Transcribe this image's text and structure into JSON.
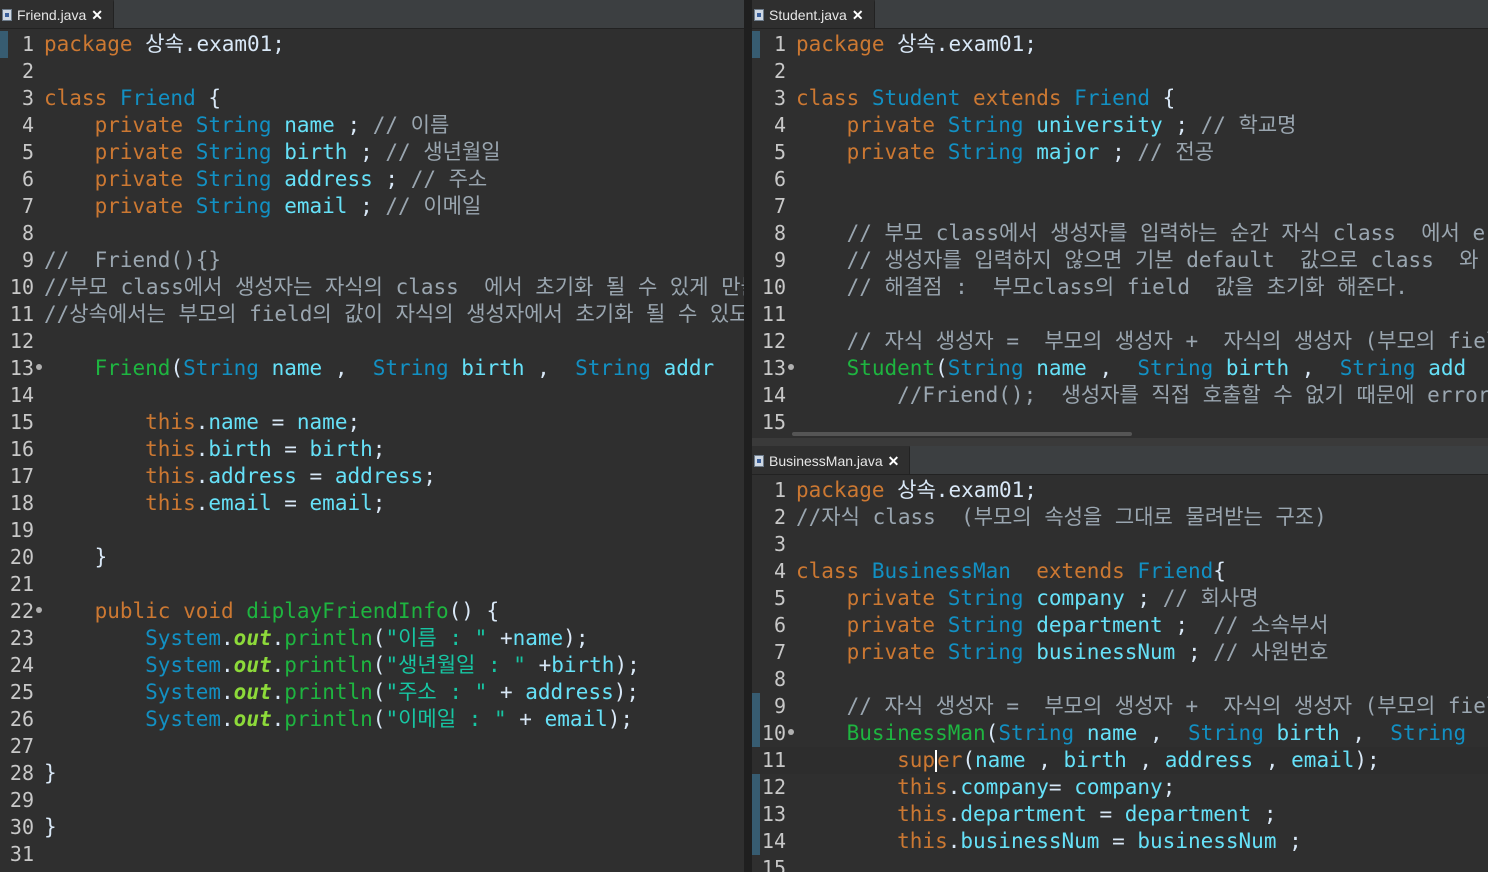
{
  "tabs": {
    "friend": "Friend.java",
    "student": "Student.java",
    "business": "BusinessMan.java"
  },
  "friend_lines": [
    [
      {
        "t": "package ",
        "c": "kw"
      },
      {
        "t": "상속.exam01;",
        "c": "pl"
      }
    ],
    [],
    [
      {
        "t": "class ",
        "c": "kw"
      },
      {
        "t": "Friend",
        "c": "ty"
      },
      {
        "t": " {",
        "c": "pl"
      }
    ],
    [
      {
        "t": "    private ",
        "c": "kw"
      },
      {
        "t": "String ",
        "c": "ty"
      },
      {
        "t": "name",
        "c": "fld"
      },
      {
        "t": " ; ",
        "c": "pl"
      },
      {
        "t": "// 이름",
        "c": "cm"
      }
    ],
    [
      {
        "t": "    private ",
        "c": "kw"
      },
      {
        "t": "String ",
        "c": "ty"
      },
      {
        "t": "birth",
        "c": "fld"
      },
      {
        "t": " ; ",
        "c": "pl"
      },
      {
        "t": "// 생년월일",
        "c": "cm"
      }
    ],
    [
      {
        "t": "    private ",
        "c": "kw"
      },
      {
        "t": "String ",
        "c": "ty"
      },
      {
        "t": "address",
        "c": "fld"
      },
      {
        "t": " ; ",
        "c": "pl"
      },
      {
        "t": "// 주소",
        "c": "cm"
      }
    ],
    [
      {
        "t": "    private ",
        "c": "kw"
      },
      {
        "t": "String ",
        "c": "ty"
      },
      {
        "t": "email",
        "c": "fld"
      },
      {
        "t": " ; ",
        "c": "pl"
      },
      {
        "t": "// 이메일",
        "c": "cm"
      }
    ],
    [],
    [
      {
        "t": "//  Friend(){}",
        "c": "cm"
      }
    ],
    [
      {
        "t": "//부모 class에서 생성자는 자식의 class  에서 초기화 될 수 있게 만들어야",
        "c": "cm"
      }
    ],
    [
      {
        "t": "//상속에서는 부모의 field의 값이 자식의 생성자에서 초기화 될 수 있도록 정",
        "c": "cm"
      }
    ],
    [],
    [
      {
        "t": "    Friend",
        "c": "meth"
      },
      {
        "t": "(",
        "c": "pl"
      },
      {
        "t": "String ",
        "c": "ty"
      },
      {
        "t": "name",
        "c": "fld"
      },
      {
        "t": " ,  ",
        "c": "pl"
      },
      {
        "t": "String ",
        "c": "ty"
      },
      {
        "t": "birth",
        "c": "fld"
      },
      {
        "t": " ,  ",
        "c": "pl"
      },
      {
        "t": "String ",
        "c": "ty"
      },
      {
        "t": "addr",
        "c": "fld"
      }
    ],
    [],
    [
      {
        "t": "        this",
        "c": "kw"
      },
      {
        "t": ".",
        "c": "pl"
      },
      {
        "t": "name",
        "c": "fld"
      },
      {
        "t": " = ",
        "c": "pl"
      },
      {
        "t": "name",
        "c": "fld"
      },
      {
        "t": ";",
        "c": "pl"
      }
    ],
    [
      {
        "t": "        this",
        "c": "kw"
      },
      {
        "t": ".",
        "c": "pl"
      },
      {
        "t": "birth",
        "c": "fld"
      },
      {
        "t": " = ",
        "c": "pl"
      },
      {
        "t": "birth",
        "c": "fld"
      },
      {
        "t": ";",
        "c": "pl"
      }
    ],
    [
      {
        "t": "        this",
        "c": "kw"
      },
      {
        "t": ".",
        "c": "pl"
      },
      {
        "t": "address",
        "c": "fld"
      },
      {
        "t": " = ",
        "c": "pl"
      },
      {
        "t": "address",
        "c": "fld"
      },
      {
        "t": ";",
        "c": "pl"
      }
    ],
    [
      {
        "t": "        this",
        "c": "kw"
      },
      {
        "t": ".",
        "c": "pl"
      },
      {
        "t": "email",
        "c": "fld"
      },
      {
        "t": " = ",
        "c": "pl"
      },
      {
        "t": "email",
        "c": "fld"
      },
      {
        "t": ";",
        "c": "pl"
      }
    ],
    [],
    [
      {
        "t": "    }",
        "c": "pl"
      }
    ],
    [],
    [
      {
        "t": "    public void ",
        "c": "kw"
      },
      {
        "t": "diplayFriendInfo",
        "c": "meth"
      },
      {
        "t": "() {",
        "c": "pl"
      }
    ],
    [
      {
        "t": "        System",
        "c": "ty"
      },
      {
        "t": ".",
        "c": "pl"
      },
      {
        "t": "out",
        "c": "stat"
      },
      {
        "t": ".",
        "c": "pl"
      },
      {
        "t": "println",
        "c": "meth"
      },
      {
        "t": "(",
        "c": "pl"
      },
      {
        "t": "\"이름 : \"",
        "c": "str"
      },
      {
        "t": " +",
        "c": "pl"
      },
      {
        "t": "name",
        "c": "fld"
      },
      {
        "t": ");",
        "c": "pl"
      }
    ],
    [
      {
        "t": "        System",
        "c": "ty"
      },
      {
        "t": ".",
        "c": "pl"
      },
      {
        "t": "out",
        "c": "stat"
      },
      {
        "t": ".",
        "c": "pl"
      },
      {
        "t": "println",
        "c": "meth"
      },
      {
        "t": "(",
        "c": "pl"
      },
      {
        "t": "\"생년월일 : \"",
        "c": "str"
      },
      {
        "t": " +",
        "c": "pl"
      },
      {
        "t": "birth",
        "c": "fld"
      },
      {
        "t": ");",
        "c": "pl"
      }
    ],
    [
      {
        "t": "        System",
        "c": "ty"
      },
      {
        "t": ".",
        "c": "pl"
      },
      {
        "t": "out",
        "c": "stat"
      },
      {
        "t": ".",
        "c": "pl"
      },
      {
        "t": "println",
        "c": "meth"
      },
      {
        "t": "(",
        "c": "pl"
      },
      {
        "t": "\"주소 : \"",
        "c": "str"
      },
      {
        "t": " + ",
        "c": "pl"
      },
      {
        "t": "address",
        "c": "fld"
      },
      {
        "t": ");",
        "c": "pl"
      }
    ],
    [
      {
        "t": "        System",
        "c": "ty"
      },
      {
        "t": ".",
        "c": "pl"
      },
      {
        "t": "out",
        "c": "stat"
      },
      {
        "t": ".",
        "c": "pl"
      },
      {
        "t": "println",
        "c": "meth"
      },
      {
        "t": "(",
        "c": "pl"
      },
      {
        "t": "\"이메일 : \"",
        "c": "str"
      },
      {
        "t": " + ",
        "c": "pl"
      },
      {
        "t": "email",
        "c": "fld"
      },
      {
        "t": ");",
        "c": "pl"
      }
    ],
    [],
    [
      {
        "t": "}",
        "c": "pl"
      }
    ],
    [],
    [
      {
        "t": "}",
        "c": "pl"
      }
    ],
    []
  ],
  "student_lines": [
    [
      {
        "t": "package ",
        "c": "kw"
      },
      {
        "t": "상속.exam01;",
        "c": "pl"
      }
    ],
    [],
    [
      {
        "t": "class ",
        "c": "kw"
      },
      {
        "t": "Student ",
        "c": "ty"
      },
      {
        "t": "extends ",
        "c": "kw"
      },
      {
        "t": "Friend",
        "c": "ty"
      },
      {
        "t": " {",
        "c": "pl"
      }
    ],
    [
      {
        "t": "    private ",
        "c": "kw"
      },
      {
        "t": "String ",
        "c": "ty"
      },
      {
        "t": "university",
        "c": "fld"
      },
      {
        "t": " ; ",
        "c": "pl"
      },
      {
        "t": "// 학교명",
        "c": "cm"
      }
    ],
    [
      {
        "t": "    private ",
        "c": "kw"
      },
      {
        "t": "String ",
        "c": "ty"
      },
      {
        "t": "major",
        "c": "fld"
      },
      {
        "t": " ; ",
        "c": "pl"
      },
      {
        "t": "// 전공",
        "c": "cm"
      }
    ],
    [],
    [],
    [
      {
        "t": "    // 부모 class에서 생성자를 입력하는 순간 자식 class  에서 error",
        "c": "cm"
      }
    ],
    [
      {
        "t": "    // 생성자를 입력하지 않으면 기본 default  값으로 class  와 같은",
        "c": "cm"
      }
    ],
    [
      {
        "t": "    // 해결점 :  부모class의 field  값을 초기화 해준다.",
        "c": "cm"
      }
    ],
    [],
    [
      {
        "t": "    // 자식 생성자 =  부모의 생성자 +  자식의 생성자 (부모의 field  초",
        "c": "cm"
      }
    ],
    [
      {
        "t": "    Student",
        "c": "meth"
      },
      {
        "t": "(",
        "c": "pl"
      },
      {
        "t": "String ",
        "c": "ty"
      },
      {
        "t": "name",
        "c": "fld"
      },
      {
        "t": " ,  ",
        "c": "pl"
      },
      {
        "t": "String ",
        "c": "ty"
      },
      {
        "t": "birth",
        "c": "fld"
      },
      {
        "t": " ,  ",
        "c": "pl"
      },
      {
        "t": "String ",
        "c": "ty"
      },
      {
        "t": "add",
        "c": "fld"
      }
    ],
    [
      {
        "t": "        //Friend();  생성자를 직접 호출할 수 없기 때문에 error를 ",
        "c": "cm"
      }
    ],
    []
  ],
  "business_lines": [
    [
      {
        "t": "package ",
        "c": "kw"
      },
      {
        "t": "상속.exam01;",
        "c": "pl"
      }
    ],
    [
      {
        "t": "//자식 class  (부모의 속성을 그대로 물려받는 구조)",
        "c": "cm"
      }
    ],
    [],
    [
      {
        "t": "class ",
        "c": "kw"
      },
      {
        "t": "BusinessMan  ",
        "c": "ty"
      },
      {
        "t": "extends ",
        "c": "kw"
      },
      {
        "t": "Friend",
        "c": "ty"
      },
      {
        "t": "{",
        "c": "pl"
      }
    ],
    [
      {
        "t": "    private ",
        "c": "kw"
      },
      {
        "t": "String ",
        "c": "ty"
      },
      {
        "t": "company",
        "c": "fld"
      },
      {
        "t": " ; ",
        "c": "pl"
      },
      {
        "t": "// 회사명",
        "c": "cm"
      }
    ],
    [
      {
        "t": "    private ",
        "c": "kw"
      },
      {
        "t": "String ",
        "c": "ty"
      },
      {
        "t": "department",
        "c": "fld"
      },
      {
        "t": " ;  ",
        "c": "pl"
      },
      {
        "t": "// 소속부서",
        "c": "cm"
      }
    ],
    [
      {
        "t": "    private ",
        "c": "kw"
      },
      {
        "t": "String ",
        "c": "ty"
      },
      {
        "t": "businessNum",
        "c": "fld"
      },
      {
        "t": " ; ",
        "c": "pl"
      },
      {
        "t": "// 사원번호",
        "c": "cm"
      }
    ],
    [],
    [
      {
        "t": "    // 자식 생성자 =  부모의 생성자 +  자식의 생성자 (부모의 field  초",
        "c": "cm"
      }
    ],
    [
      {
        "t": "    BusinessMan",
        "c": "meth"
      },
      {
        "t": "(",
        "c": "pl"
      },
      {
        "t": "String ",
        "c": "ty"
      },
      {
        "t": "name",
        "c": "fld"
      },
      {
        "t": " ,  ",
        "c": "pl"
      },
      {
        "t": "String ",
        "c": "ty"
      },
      {
        "t": "birth",
        "c": "fld"
      },
      {
        "t": " ,  ",
        "c": "pl"
      },
      {
        "t": "String",
        "c": "ty"
      }
    ],
    [
      {
        "t": "        super",
        "c": "kw"
      },
      {
        "t": "(",
        "c": "pl"
      },
      {
        "t": "name",
        "c": "fld"
      },
      {
        "t": " , ",
        "c": "pl"
      },
      {
        "t": "birth",
        "c": "fld"
      },
      {
        "t": " , ",
        "c": "pl"
      },
      {
        "t": "address",
        "c": "fld"
      },
      {
        "t": " , ",
        "c": "pl"
      },
      {
        "t": "email",
        "c": "fld"
      },
      {
        "t": ");",
        "c": "pl"
      }
    ],
    [
      {
        "t": "        this",
        "c": "kw"
      },
      {
        "t": ".",
        "c": "pl"
      },
      {
        "t": "company",
        "c": "fld"
      },
      {
        "t": "= ",
        "c": "pl"
      },
      {
        "t": "company",
        "c": "fld"
      },
      {
        "t": ";",
        "c": "pl"
      }
    ],
    [
      {
        "t": "        this",
        "c": "kw"
      },
      {
        "t": ".",
        "c": "pl"
      },
      {
        "t": "department",
        "c": "fld"
      },
      {
        "t": " = ",
        "c": "pl"
      },
      {
        "t": "department",
        "c": "fld"
      },
      {
        "t": " ;",
        "c": "pl"
      }
    ],
    [
      {
        "t": "        this",
        "c": "kw"
      },
      {
        "t": ".",
        "c": "pl"
      },
      {
        "t": "businessNum",
        "c": "fld"
      },
      {
        "t": " = ",
        "c": "pl"
      },
      {
        "t": "businessNum",
        "c": "fld"
      },
      {
        "t": " ;",
        "c": "pl"
      }
    ],
    []
  ]
}
